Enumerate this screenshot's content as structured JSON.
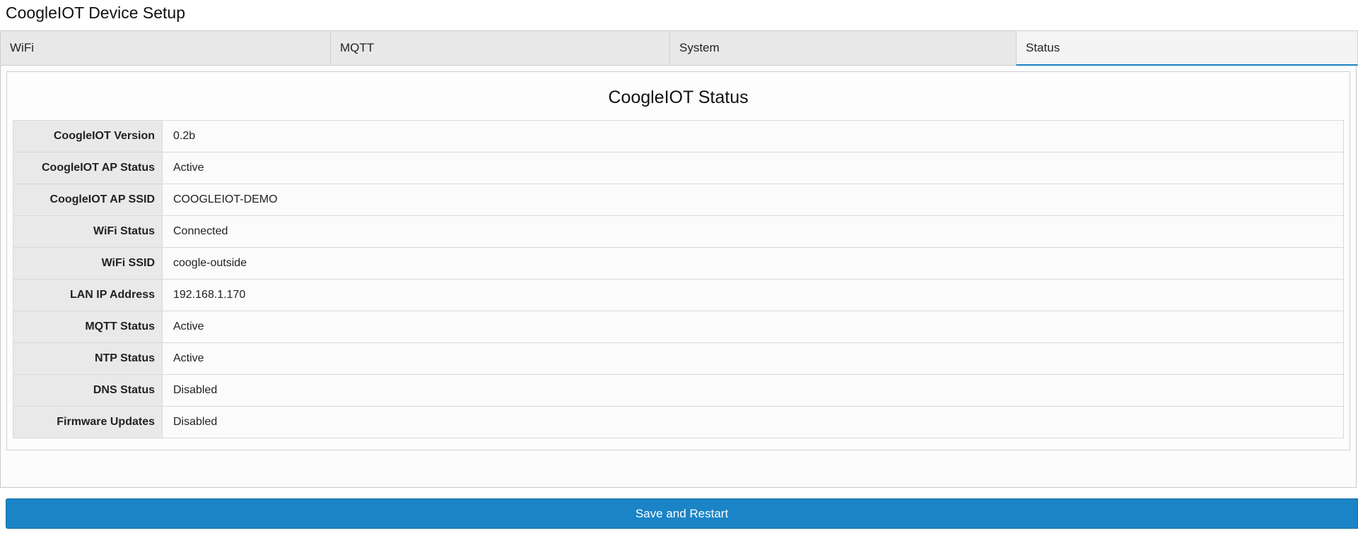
{
  "header": {
    "title": "CoogleIOT Device Setup"
  },
  "tabs": [
    {
      "label": "WiFi",
      "active": false
    },
    {
      "label": "MQTT",
      "active": false
    },
    {
      "label": "System",
      "active": false
    },
    {
      "label": "Status",
      "active": true
    }
  ],
  "status": {
    "title": "CoogleIOT Status",
    "rows": [
      {
        "label": "CoogleIOT Version",
        "value": "0.2b"
      },
      {
        "label": "CoogleIOT AP Status",
        "value": "Active"
      },
      {
        "label": "CoogleIOT AP SSID",
        "value": "COOGLEIOT-DEMO"
      },
      {
        "label": "WiFi Status",
        "value": "Connected"
      },
      {
        "label": "WiFi SSID",
        "value": "coogle-outside"
      },
      {
        "label": "LAN IP Address",
        "value": "192.168.1.170"
      },
      {
        "label": "MQTT Status",
        "value": "Active"
      },
      {
        "label": "NTP Status",
        "value": "Active"
      },
      {
        "label": "DNS Status",
        "value": "Disabled"
      },
      {
        "label": "Firmware Updates",
        "value": "Disabled"
      }
    ]
  },
  "footer": {
    "save_label": "Save and Restart"
  },
  "colors": {
    "accent": "#1a84c6",
    "tab_background": "#e8e8e8",
    "label_background": "#e9e9e9"
  }
}
